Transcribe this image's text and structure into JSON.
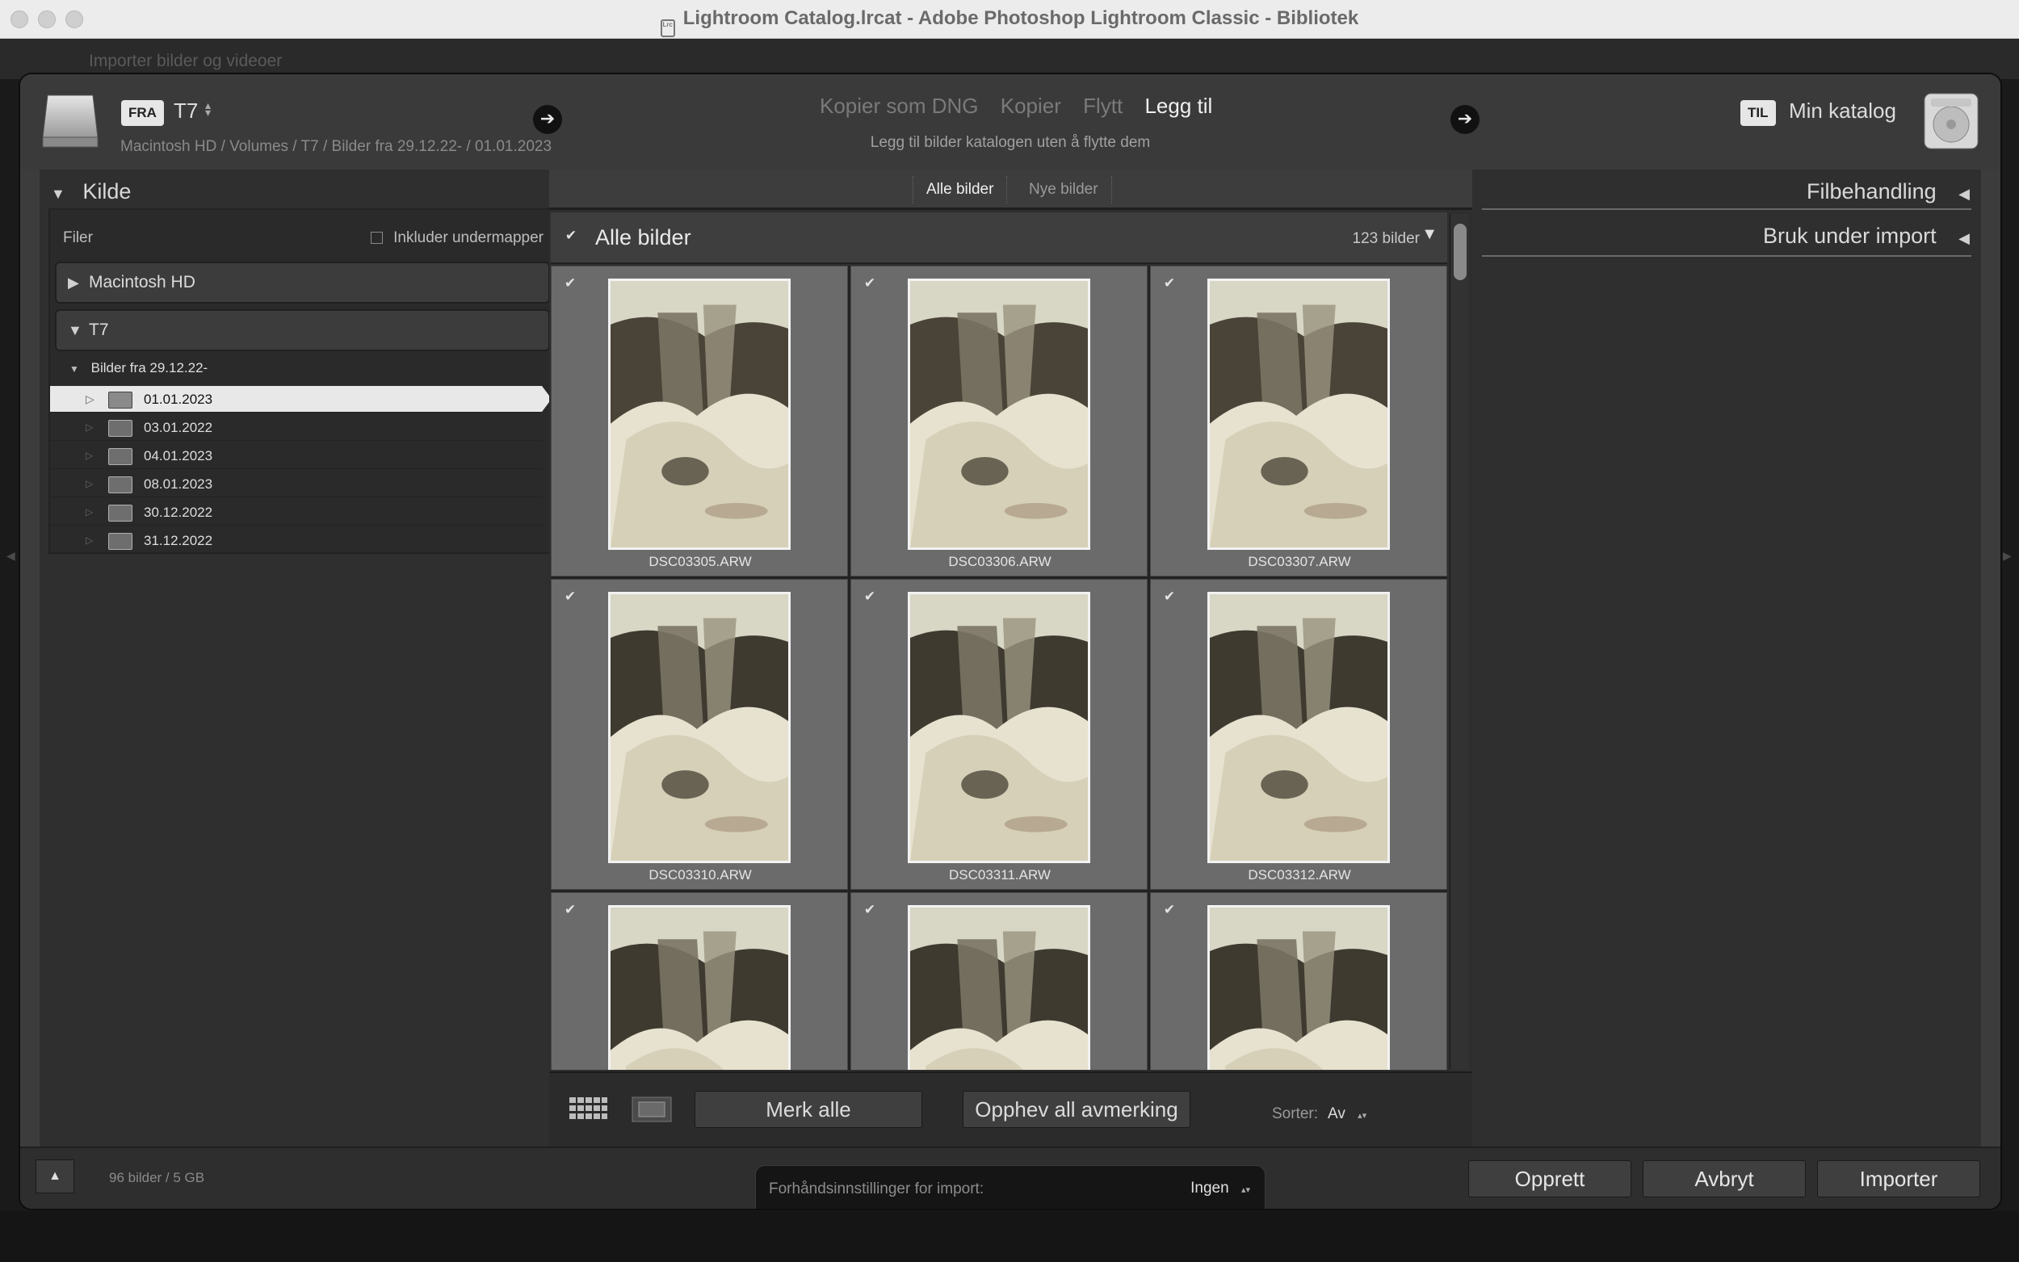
{
  "window": {
    "title": "Lightroom Catalog.lrcat - Adobe Photoshop Lightroom Classic - Bibliotek",
    "bg_label": "Importer bilder og videoer"
  },
  "header": {
    "from_tag": "FRA",
    "source_name": "T7",
    "source_path": "Macintosh HD / Volumes / T7 / Bilder fra 29.12.22- / 01.01.2023",
    "modes": [
      "Kopier som DNG",
      "Kopier",
      "Flytt",
      "Legg til"
    ],
    "active_mode": "Legg til",
    "mode_description": "Legg til bilder katalogen uten å flytte dem",
    "to_tag": "TIL",
    "destination_name": "Min katalog"
  },
  "left_panel": {
    "title": "Kilde",
    "files_label": "Filer",
    "include_subfolders": "Inkluder undermapper",
    "volumes": [
      "Macintosh HD",
      "T7"
    ],
    "parent_folder": "Bilder fra 29.12.22-",
    "folders": [
      {
        "name": "01.01.2023",
        "selected": true
      },
      {
        "name": "03.01.2022",
        "selected": false
      },
      {
        "name": "04.01.2023",
        "selected": false
      },
      {
        "name": "08.01.2023",
        "selected": false
      },
      {
        "name": "30.12.2022",
        "selected": false
      },
      {
        "name": "31.12.2022",
        "selected": false
      }
    ]
  },
  "center": {
    "tabs": [
      "Alle bilder",
      "Nye bilder"
    ],
    "active_tab": "Alle bilder",
    "grid_title": "Alle bilder",
    "grid_count": "123 bilder",
    "files": [
      "DSC03305.ARW",
      "DSC03306.ARW",
      "DSC03307.ARW",
      "DSC03310.ARW",
      "DSC03311.ARW",
      "DSC03312.ARW",
      "",
      "",
      ""
    ],
    "check_all": "Merk alle",
    "uncheck_all": "Opphev all avmerking",
    "sort_label": "Sorter:",
    "sort_value": "Av"
  },
  "right_panel": {
    "sections": [
      "Filbehandling",
      "Bruk under import"
    ]
  },
  "footer": {
    "count": "96 bilder / 5 GB",
    "preset_label": "Forhåndsinnstillinger for import:",
    "preset_value": "Ingen",
    "create": "Opprett",
    "cancel": "Avbryt",
    "import": "Importer"
  },
  "colors": {
    "panel_bg": "#2f2f2f",
    "cell_bg": "#6b6b6b",
    "selected_row": "#e8e8e8",
    "active_text": "#f0f0f0"
  }
}
